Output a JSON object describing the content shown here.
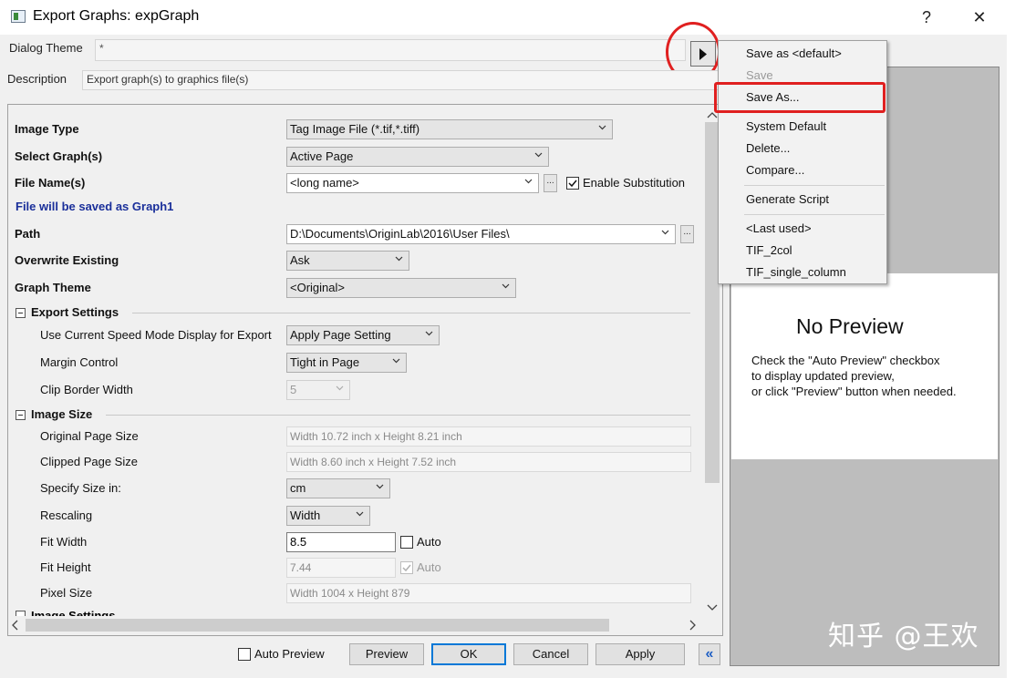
{
  "window": {
    "title": "Export Graphs: expGraph",
    "help": "?",
    "close": "✕"
  },
  "theme": {
    "label": "Dialog Theme",
    "value": "*"
  },
  "description": {
    "label": "Description",
    "value": "Export graph(s) to graphics file(s)"
  },
  "form": {
    "image_type": {
      "label": "Image Type",
      "value": "Tag Image File (*.tif,*.tiff)"
    },
    "select_graphs": {
      "label": "Select Graph(s)",
      "value": "Active Page"
    },
    "file_name": {
      "label": "File Name(s)",
      "value": "<long name>",
      "substitution": "Enable Substitution"
    },
    "save_note": "File will be saved as Graph1",
    "path": {
      "label": "Path",
      "value": "D:\\Documents\\OriginLab\\2016\\User Files\\"
    },
    "overwrite": {
      "label": "Overwrite Existing",
      "value": "Ask"
    },
    "graph_theme": {
      "label": "Graph Theme",
      "value": "<Original>"
    },
    "export_settings": {
      "header": "Export Settings",
      "speed_mode": {
        "label": "Use Current Speed Mode Display for Export",
        "value": "Apply Page Setting"
      },
      "margin": {
        "label": "Margin Control",
        "value": "Tight in Page"
      },
      "clip_border": {
        "label": "Clip Border Width",
        "value": "5"
      }
    },
    "image_size": {
      "header": "Image Size",
      "original": {
        "label": "Original Page Size",
        "value": "Width 10.72 inch x Height 8.21 inch"
      },
      "clipped": {
        "label": "Clipped Page Size",
        "value": "Width 8.60 inch x Height 7.52 inch"
      },
      "specify": {
        "label": "Specify Size in:",
        "value": "cm"
      },
      "rescaling": {
        "label": "Rescaling",
        "value": "Width"
      },
      "fit_width": {
        "label": "Fit Width",
        "value": "8.5",
        "auto": "Auto"
      },
      "fit_height": {
        "label": "Fit Height",
        "value": "7.44",
        "auto": "Auto"
      },
      "pixel": {
        "label": "Pixel Size",
        "value": "Width 1004 x Height 879"
      }
    },
    "image_settings_partial": "Image Settings"
  },
  "buttons": {
    "auto_preview": "Auto Preview",
    "preview": "Preview",
    "ok": "OK",
    "cancel": "Cancel",
    "apply": "Apply",
    "collapse": "«"
  },
  "preview": {
    "title": "No Preview",
    "line1": "Check the \"Auto Preview\" checkbox",
    "line2": "to display updated preview,",
    "line3": "or click \"Preview\" button when needed."
  },
  "menu": {
    "items": [
      "Save as <default>",
      "Save",
      "Save As...",
      "System Default",
      "Delete...",
      "Compare...",
      "Generate Script",
      "<Last used>",
      "TIF_2col",
      "TIF_single_column"
    ]
  },
  "watermark": "知乎 @王欢",
  "colors": {
    "highlight_red": "#e02020",
    "note_blue": "#1a2f9a",
    "dialog_bg": "#f0f0f0"
  }
}
